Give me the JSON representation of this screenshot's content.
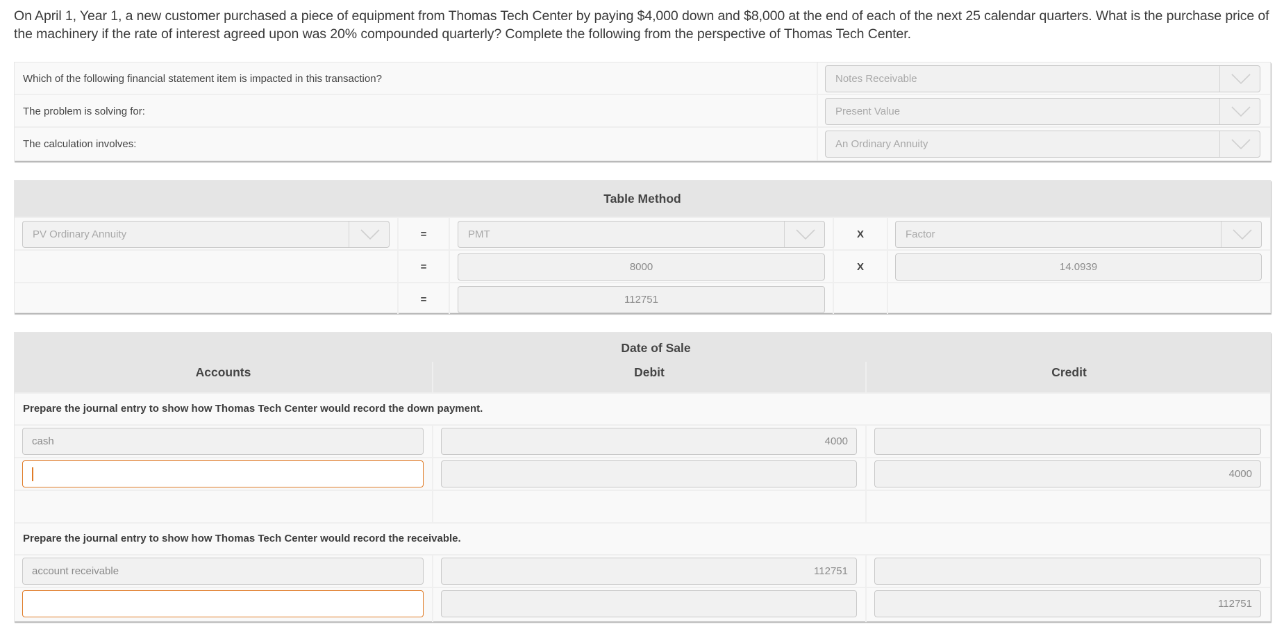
{
  "question": "On April 1, Year 1, a new customer purchased a piece of equipment from Thomas Tech Center by paying $4,000 down and $8,000 at the end of each of the next 25 calendar quarters. What is the purchase price of the machinery if the rate of interest agreed upon was 20% compounded quarterly? Complete the following from the perspective of Thomas Tech Center.",
  "questions_panel": {
    "rows": [
      {
        "label": "Which of the following financial statement item is impacted in this transaction?",
        "selected": "Notes Receivable"
      },
      {
        "label": "The problem is solving for:",
        "selected": "Present Value"
      },
      {
        "label": "The calculation involves:",
        "selected": "An Ordinary Annuity"
      }
    ]
  },
  "table_method": {
    "title": "Table Method",
    "row1": {
      "left_select": "PV Ordinary Annuity",
      "eq": "=",
      "mid_select": "PMT",
      "op": "X",
      "right_select": "Factor"
    },
    "row2": {
      "eq": "=",
      "mid_value": "8000",
      "op": "X",
      "right_value": "14.0939"
    },
    "row3": {
      "eq": "=",
      "mid_value": "112751"
    }
  },
  "journal": {
    "header_group": "Date of Sale",
    "col_accounts": "Accounts",
    "col_debit": "Debit",
    "col_credit": "Credit",
    "sections": [
      {
        "instruction": "Prepare the journal entry to show how Thomas Tech Center would record the down payment.",
        "lines": [
          {
            "account": "cash",
            "debit": "4000",
            "credit": ""
          },
          {
            "account": "",
            "debit": "",
            "credit": "4000"
          }
        ]
      },
      {
        "instruction": "Prepare the journal entry to show how Thomas Tech Center would record the receivable.",
        "lines": [
          {
            "account": "account receivable",
            "debit": "112751",
            "credit": ""
          },
          {
            "account": "",
            "debit": "",
            "credit": "112751"
          }
        ]
      }
    ]
  },
  "colors": {
    "focus_border": "#e07b27",
    "header_bg": "#e5e5e5",
    "panel_bg": "#f9f9f9",
    "field_bg": "#f1f1f1"
  }
}
